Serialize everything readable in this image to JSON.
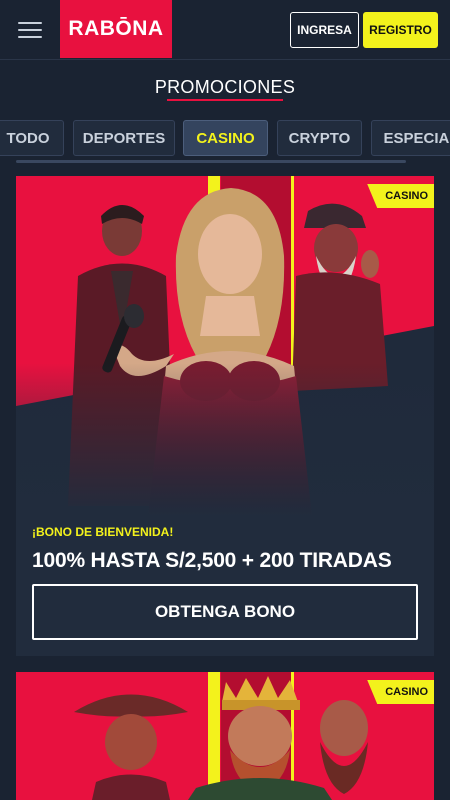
{
  "header": {
    "menu_icon": "hamburger-menu-icon",
    "logo_text": "RABŌNA",
    "login_label": "INGRESA",
    "register_label": "REGISTRO"
  },
  "page": {
    "title": "PROMOCIONES"
  },
  "tabs": [
    {
      "label": "TODO",
      "active": false
    },
    {
      "label": "DEPORTES",
      "active": false
    },
    {
      "label": "CASINO",
      "active": true
    },
    {
      "label": "CRYPTO",
      "active": false
    },
    {
      "label": "ESPECIAL",
      "active": false
    }
  ],
  "promos": [
    {
      "badge": "CASINO",
      "kicker": "¡BONO DE BIENVENIDA!",
      "title": "100% HASTA S/2,500 + 200 TIRADAS",
      "cta": "OBTENGA BONO"
    },
    {
      "badge": "CASINO"
    }
  ],
  "colors": {
    "brand_red": "#e8113f",
    "accent_yellow": "#f3f21c",
    "background": "#1a2332",
    "card": "#212c3d"
  }
}
